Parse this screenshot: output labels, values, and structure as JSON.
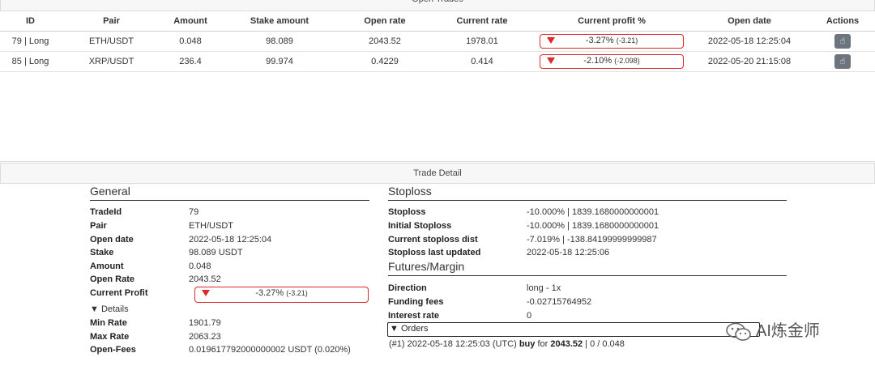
{
  "open_trades": {
    "title": "Open Trades",
    "columns": [
      "ID",
      "Pair",
      "Amount",
      "Stake amount",
      "Open rate",
      "Current rate",
      "Current profit %",
      "Open date",
      "Actions"
    ],
    "rows": [
      {
        "id": "79 | Long",
        "pair": "ETH/USDT",
        "amount": "0.048",
        "stake": "98.089",
        "open_rate": "2043.52",
        "current_rate": "1978.01",
        "profit_pct": "-3.27%",
        "profit_abs": "(-3.21)",
        "open_date": "2022-05-18 12:25:04"
      },
      {
        "id": "85 | Long",
        "pair": "XRP/USDT",
        "amount": "236.4",
        "stake": "99.974",
        "open_rate": "0.4229",
        "current_rate": "0.414",
        "profit_pct": "-2.10%",
        "profit_abs": "(-2.098)",
        "open_date": "2022-05-20 21:15:08"
      }
    ]
  },
  "trade_detail": {
    "title": "Trade Detail",
    "general": {
      "title": "General",
      "items": [
        {
          "k": "TradeId",
          "v": "79"
        },
        {
          "k": "Pair",
          "v": "ETH/USDT"
        },
        {
          "k": "Open date",
          "v": "2022-05-18 12:25:04"
        },
        {
          "k": "Stake",
          "v": "98.089 USDT"
        },
        {
          "k": "Amount",
          "v": "0.048"
        },
        {
          "k": "Open Rate",
          "v": "2043.52"
        }
      ],
      "current_profit_label": "Current Profit",
      "current_profit_pct": "-3.27%",
      "current_profit_abs": "(-3.21)",
      "details_label": "▼ Details",
      "details_items": [
        {
          "k": "Min Rate",
          "v": "1901.79"
        },
        {
          "k": "Max Rate",
          "v": "2063.23"
        },
        {
          "k": "Open-Fees",
          "v": "0.019617792000000002 USDT (0.020%)"
        }
      ]
    },
    "stoploss": {
      "title": "Stoploss",
      "items": [
        {
          "k": "Stoploss",
          "v": "-10.000% | 1839.1680000000001"
        },
        {
          "k": "Initial Stoploss",
          "v": "-10.000% | 1839.1680000000001"
        },
        {
          "k": "Current stoploss dist",
          "v": "-7.019% | -138.84199999999987"
        },
        {
          "k": "Stoploss last updated",
          "v": "2022-05-18 12:25:06"
        }
      ]
    },
    "futures": {
      "title": "Futures/Margin",
      "items": [
        {
          "k": "Direction",
          "v": "long - 1x"
        },
        {
          "k": "Funding fees",
          "v": "-0.02715764952"
        },
        {
          "k": "Interest rate",
          "v": "0"
        }
      ]
    },
    "orders": {
      "label": "▼ Orders",
      "line_prefix": "(#1) 2022-05-18 12:25:03 (UTC)",
      "line_side": "buy",
      "line_for": "for",
      "line_price": "2043.52",
      "line_suffix": "| 0 / 0.048"
    }
  },
  "watermark": "AI炼金师",
  "colors": {
    "loss": "#e0282c",
    "button": "#6c757d"
  }
}
